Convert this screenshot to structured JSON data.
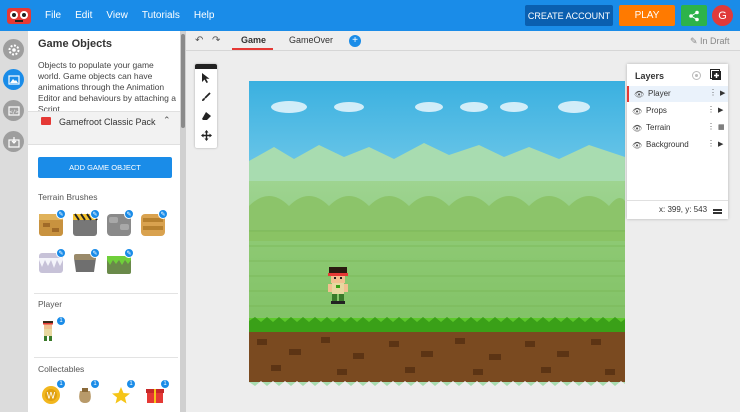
{
  "menu": [
    "File",
    "Edit",
    "View",
    "Tutorials",
    "Help"
  ],
  "header": {
    "create_account": "CREATE ACCOUNT",
    "play": "PLAY",
    "avatar_letter": "G"
  },
  "rail_icons": [
    "gear-icon",
    "image-icon",
    "code-icon",
    "import-icon"
  ],
  "panel": {
    "title": "Game Objects",
    "description": "Objects to populate your game world. Game objects can have animations through the Animation Editor and behaviours by attaching a Script",
    "pack_name": "Gamefroot Classic Pack",
    "add_button": "ADD GAME OBJECT",
    "sections": {
      "terrain": "Terrain Brushes",
      "player": "Player",
      "collectables": "Collectables"
    }
  },
  "tabs": {
    "game": "Game",
    "gameover": "GameOver",
    "status": "In Draft"
  },
  "layers": {
    "title": "Layers",
    "items": [
      "Player",
      "Props",
      "Terrain",
      "Background"
    ],
    "coords": "x: 399, y: 543"
  },
  "colors": {
    "brand": "#1a8ce8",
    "play": "#ff7a00",
    "share": "#2db34a",
    "accent_red": "#e53935"
  }
}
